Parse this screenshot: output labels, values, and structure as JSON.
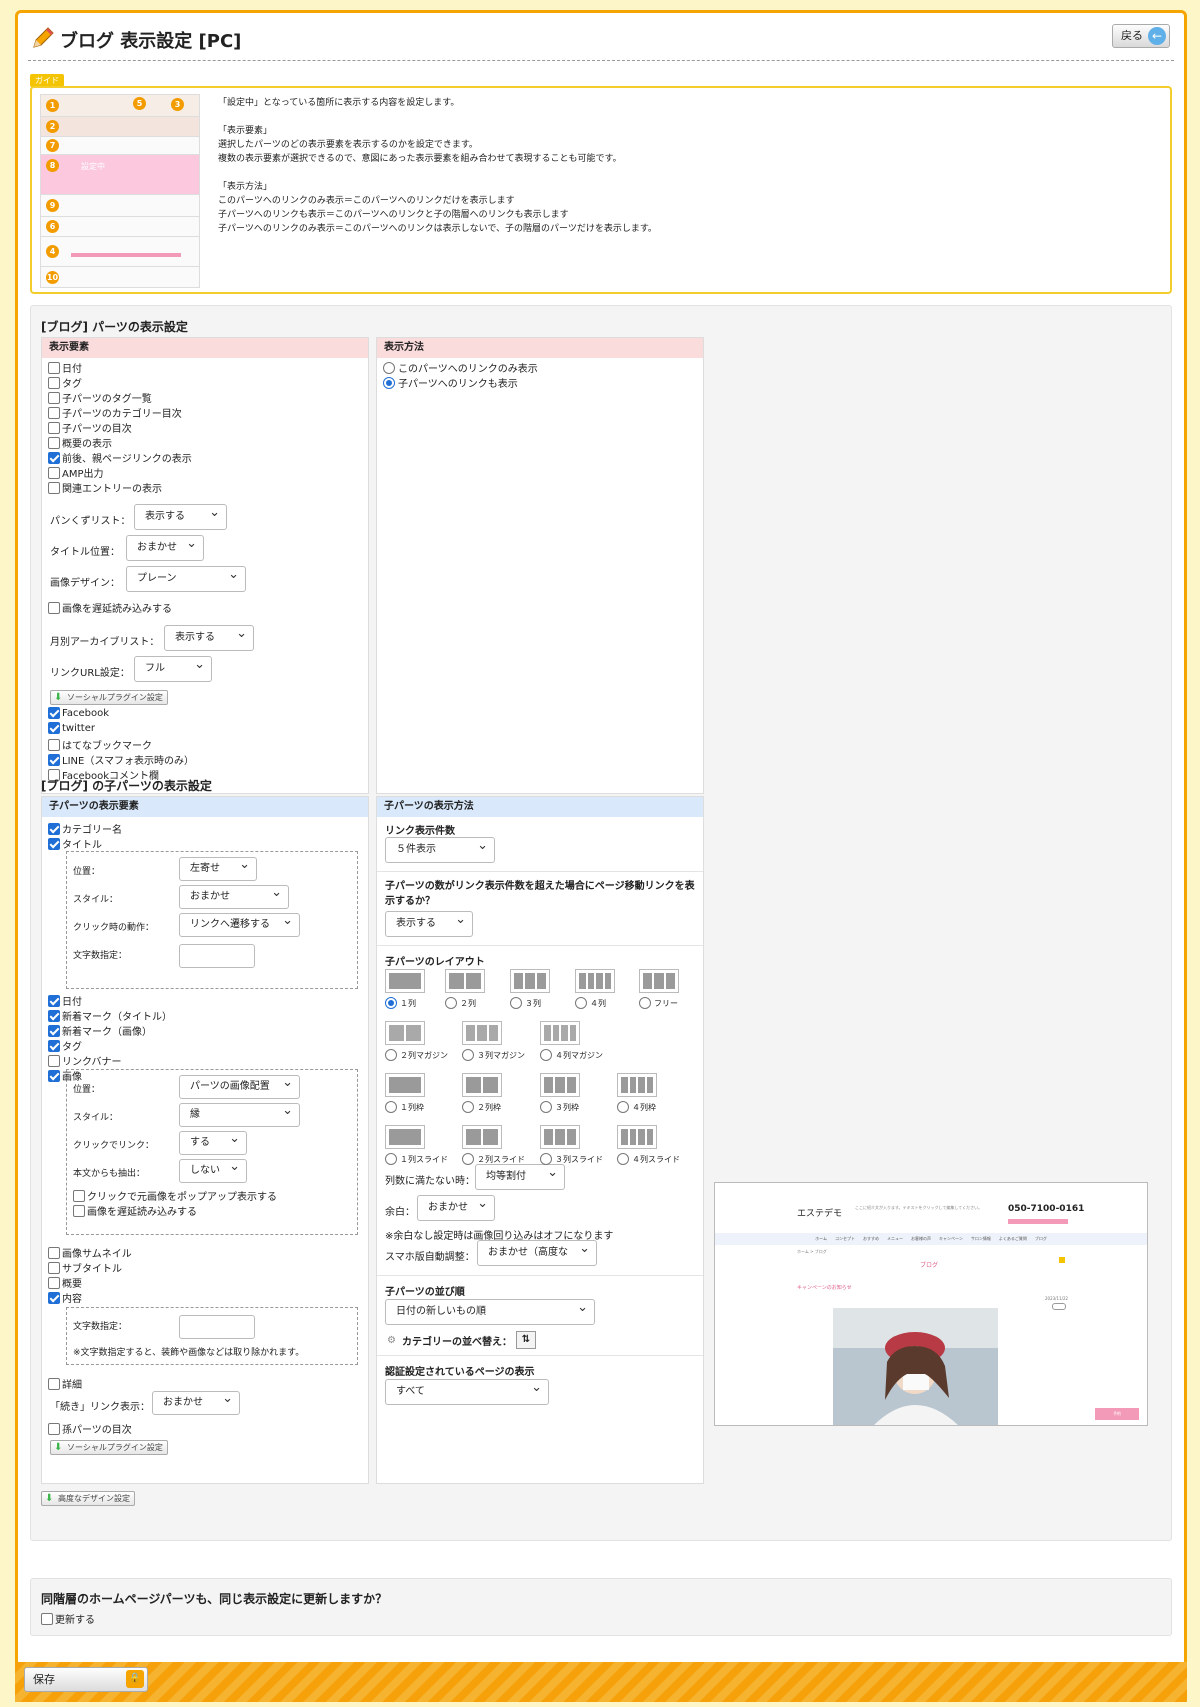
{
  "header": {
    "title": "ブログ 表示設定 [PC]",
    "back_label": "戻る"
  },
  "guide": {
    "tag": "ガイド",
    "slot_label": "設定中",
    "numbers": [
      "1",
      "2",
      "7",
      "8",
      "9",
      "6",
      "4",
      "10",
      "5",
      "3"
    ],
    "text": "「設定中」となっている箇所に表示する内容を設定します。\n\n「表示要素」\n選択したパーツのどの表示要素を表示するのかを設定できます。\n複数の表示要素が選択できるので、意図にあった表示要素を組み合わせて表現することも可能です。\n\n「表示方法」\nこのパーツへのリンクのみ表示＝このパーツへのリンクだけを表示します\n子パーツへのリンクも表示＝このパーツへのリンクと子の階層へのリンクも表示します\n子パーツへのリンクのみ表示＝このパーツへのリンクは表示しないで、子の階層のパーツだけを表示します。"
  },
  "parts": {
    "title": "[ブログ] パーツの表示設定",
    "elements_head": "表示要素",
    "method_head": "表示方法",
    "checkboxes": [
      {
        "label": "日付",
        "checked": false
      },
      {
        "label": "タグ",
        "checked": false
      },
      {
        "label": "子パーツのタグ一覧",
        "checked": false
      },
      {
        "label": "子パーツのカテゴリー目次",
        "checked": false
      },
      {
        "label": "子パーツの目次",
        "checked": false
      },
      {
        "label": "概要の表示",
        "checked": false
      },
      {
        "label": "前後、親ページリンクの表示",
        "checked": true
      },
      {
        "label": "AMP出力",
        "checked": false
      },
      {
        "label": "関連エントリーの表示",
        "checked": false
      }
    ],
    "breadcrumb_label": "パンくずリスト：",
    "breadcrumb_value": "表示する",
    "title_pos_label": "タイトル位置：",
    "title_pos_value": "おまかせ",
    "image_design_label": "画像デザイン：",
    "image_design_value": "プレーン",
    "lazy_label": "画像を遅延読み込みする",
    "archive_label": "月別アーカイブリスト：",
    "archive_value": "表示する",
    "link_url_label": "リンクURL設定：",
    "link_url_value": "フル",
    "social_btn": "ソーシャルプラグイン設定",
    "social": [
      {
        "label": "Facebook",
        "checked": true
      },
      {
        "label": "twitter",
        "checked": true
      },
      {
        "label": "はてなブックマーク",
        "checked": false
      },
      {
        "label": "LINE（スマフォ表示時のみ）",
        "checked": true
      },
      {
        "label": "Facebookコメント欄",
        "checked": false
      }
    ],
    "methods": [
      {
        "label": "このパーツへのリンクのみ表示",
        "checked": false
      },
      {
        "label": "子パーツへのリンクも表示",
        "checked": true
      }
    ]
  },
  "child": {
    "title": "[ブログ] の子パーツの表示設定",
    "elements_head": "子パーツの表示要素",
    "method_head": "子パーツの表示方法",
    "cat_name": "カテゴリー名",
    "title_cb": "タイトル",
    "pos_label": "位置：",
    "pos_value": "左寄せ",
    "style_label": "スタイル：",
    "style_value": "おまかせ",
    "click_label": "クリック時の動作：",
    "click_value": "リンクへ遷移する",
    "chars_label": "文字数指定：",
    "checks2": [
      {
        "label": "日付",
        "checked": true
      },
      {
        "label": "新着マーク（タイトル）",
        "checked": true
      },
      {
        "label": "新着マーク（画像）",
        "checked": true
      },
      {
        "label": "タグ",
        "checked": true
      },
      {
        "label": "リンクバナー",
        "checked": false
      },
      {
        "label": "画像",
        "checked": true
      }
    ],
    "img_pos_label": "位置：",
    "img_pos_value": "パーツの画像配置",
    "img_style_label": "スタイル：",
    "img_style_value": "縁",
    "img_click_label": "クリックでリンク：",
    "img_click_value": "する",
    "img_extract_label": "本文からも抽出：",
    "img_extract_value": "しない",
    "popup_label": "クリックで元画像をポップアップ表示する",
    "img_lazy_label": "画像を遅延読み込みする",
    "checks3": [
      {
        "label": "画像サムネイル",
        "checked": false
      },
      {
        "label": "サブタイトル",
        "checked": false
      },
      {
        "label": "概要",
        "checked": false
      },
      {
        "label": "内容",
        "checked": true
      }
    ],
    "content_chars_label": "文字数指定：",
    "content_note": "※文字数指定すると、装飾や画像などは取り除かれます。",
    "detail_label": "詳細",
    "more_label": "「続き」リンク表示：",
    "more_value": "おまかせ",
    "grand_label": "孫パーツの目次",
    "social_btn": "ソーシャルプラグイン設定",
    "link_count_label": "リンク表示件数",
    "link_count_value": "５件表示",
    "overflow_label": "子パーツの数がリンク表示件数を超えた場合にページ移動リンクを表示するか？",
    "overflow_value": "表示する",
    "layout_label": "子パーツのレイアウト",
    "layouts_row1": [
      "１列",
      "２列",
      "３列",
      "４列",
      "フリー"
    ],
    "layouts_row2": [
      "２列マガジン",
      "３列マガジン",
      "４列マガジン"
    ],
    "layouts_row3": [
      "１列枠",
      "２列枠",
      "３列枠",
      "４列枠"
    ],
    "layouts_row4": [
      "１列スライド",
      "２列スライド",
      "３列スライド",
      "４列スライド"
    ],
    "fill_label": "列数に満たない時：",
    "fill_value": "均等割付",
    "margin_label": "余白：",
    "margin_value": "おまかせ",
    "margin_note": "※余白なし設定時は画像回り込みはオフになります",
    "sp_label": "スマホ版自動調整：",
    "sp_value": "おまかせ（高度な",
    "order_label": "子パーツの並び順",
    "order_value": "日付の新しいもの順",
    "cat_sort_label": "カテゴリーの並べ替え：",
    "auth_label": "認証設定されているページの表示",
    "auth_value": "すべて"
  },
  "advanced_btn": "高度なデザイン設定",
  "same_level": {
    "question": "同階層のホームページパーツも、同じ表示設定に更新しますか？",
    "checkbox": "更新する"
  },
  "preview": {
    "shop": "エステデモ",
    "tagline": "ここに紹介文が入ります。テキストをクリックして編集してください。",
    "phone": "050-7100-0161",
    "nav": [
      "ホーム",
      "コンセプト",
      "おすすめ",
      "メニュー",
      "お客様の声",
      "キャンペーン",
      "サロン情報",
      "よくあるご質問",
      "ブログ"
    ],
    "breadcrumb": "ホーム > ブログ",
    "blog_title": "ブログ",
    "post_title": "キャンペーンのお知らせ",
    "date": "2023/11/22",
    "cta": "予約"
  },
  "save_label": "保存",
  "colors": {
    "accent": "#f5a400",
    "pink_head": "#fbdcdc",
    "blue_head": "#d9e9fb",
    "check": "#1f6fd6"
  }
}
